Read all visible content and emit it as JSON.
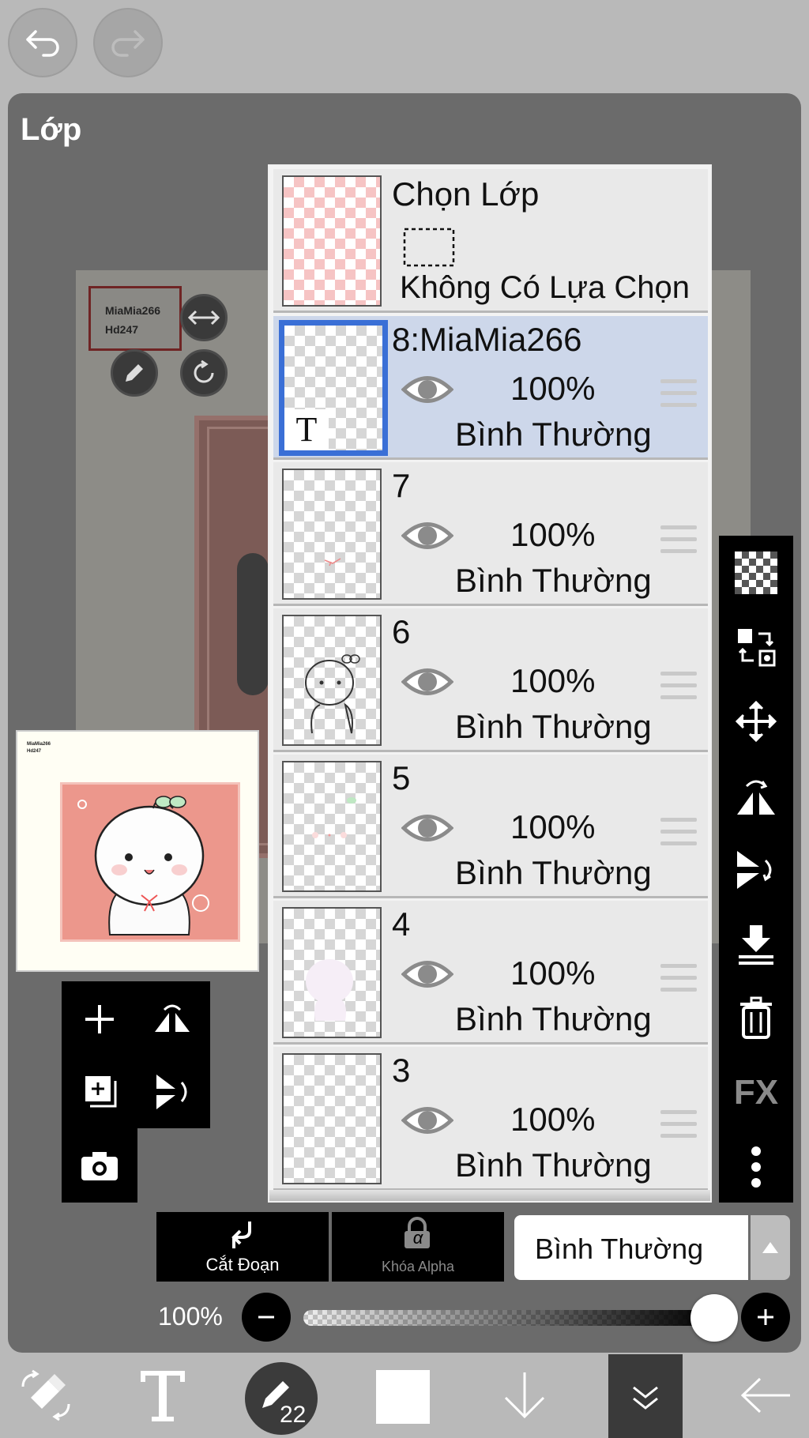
{
  "panel": {
    "title": "Lớp"
  },
  "canvas": {
    "watermark_line1": "MiaMia266",
    "watermark_line2": "Hd247"
  },
  "navigator": {
    "watermark_line1": "MiaMia266",
    "watermark_line2": "Hd247"
  },
  "selection_layer": {
    "title": "Chọn Lớp",
    "status": "Không Có Lựa Chọn"
  },
  "layers": [
    {
      "name": "8:MiaMia266",
      "opacity": "100%",
      "blend": "Bình Thường",
      "selected": true,
      "text_layer_glyph": "T"
    },
    {
      "name": "7",
      "opacity": "100%",
      "blend": "Bình Thường"
    },
    {
      "name": "6",
      "opacity": "100%",
      "blend": "Bình Thường"
    },
    {
      "name": "5",
      "opacity": "100%",
      "blend": "Bình Thường"
    },
    {
      "name": "4",
      "opacity": "100%",
      "blend": "Bình Thường"
    },
    {
      "name": "3",
      "opacity": "100%",
      "blend": "Bình Thường"
    }
  ],
  "right_tools": {
    "fx_label": "FX"
  },
  "bottom_controls": {
    "clip_label": "Cắt Đoạn",
    "alpha_lock_label": "Khóa Alpha",
    "alpha_glyph": "α",
    "blend_mode": "Bình Thường",
    "opacity_label": "100%",
    "opacity_value": 1.0
  },
  "toolbar": {
    "brush_size": "22"
  },
  "colors": {
    "selected_border": "#3a6fd6",
    "selected_bg": "#cdd7ea",
    "panel_bg": "#6b6b6b"
  }
}
